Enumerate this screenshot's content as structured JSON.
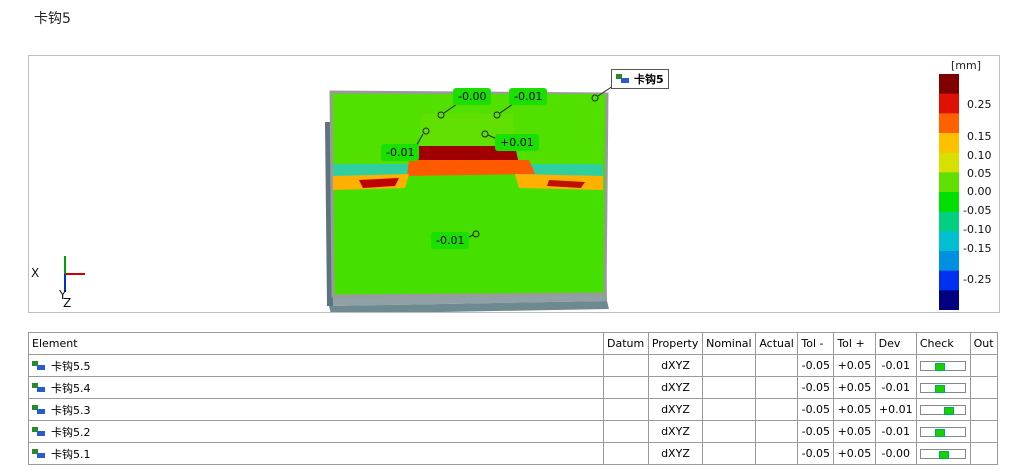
{
  "page": {
    "title": "卡钩5"
  },
  "viewport": {
    "tag_label": "卡钩5",
    "annotations": [
      {
        "id": "a1",
        "value": "-0.00"
      },
      {
        "id": "a2",
        "value": "-0.01"
      },
      {
        "id": "a3",
        "value": "-0.01"
      },
      {
        "id": "a4",
        "value": "+0.01"
      },
      {
        "id": "a5",
        "value": "-0.01"
      }
    ],
    "legend": {
      "unit": "[mm]",
      "ticks": [
        "0.25",
        "0.15",
        "0.10",
        "0.05",
        "0.00",
        "-0.05",
        "-0.10",
        "-0.15",
        "-0.25"
      ],
      "colors": [
        "#800000",
        "#e01000",
        "#ff6000",
        "#ffc000",
        "#d8e000",
        "#60e000",
        "#00e000",
        "#00d080",
        "#00c0d0",
        "#0090e0",
        "#0030f0",
        "#000080"
      ]
    },
    "axes": {
      "x": "X",
      "y": "Y",
      "z": "Z"
    }
  },
  "table": {
    "headers": [
      "Element",
      "Datum",
      "Property",
      "Nominal",
      "Actual",
      "Tol -",
      "Tol +",
      "Dev",
      "Check",
      "Out"
    ],
    "rows": [
      {
        "element": "卡钩5.5",
        "datum": "",
        "property": "dXYZ",
        "nominal": "",
        "actual": "",
        "tol_minus": "-0.05",
        "tol_plus": "+0.05",
        "dev": "-0.01",
        "check_pos": -0.2,
        "out": ""
      },
      {
        "element": "卡钩5.4",
        "datum": "",
        "property": "dXYZ",
        "nominal": "",
        "actual": "",
        "tol_minus": "-0.05",
        "tol_plus": "+0.05",
        "dev": "-0.01",
        "check_pos": -0.2,
        "out": ""
      },
      {
        "element": "卡钩5.3",
        "datum": "",
        "property": "dXYZ",
        "nominal": "",
        "actual": "",
        "tol_minus": "-0.05",
        "tol_plus": "+0.05",
        "dev": "+0.01",
        "check_pos": 0.2,
        "out": ""
      },
      {
        "element": "卡钩5.2",
        "datum": "",
        "property": "dXYZ",
        "nominal": "",
        "actual": "",
        "tol_minus": "-0.05",
        "tol_plus": "+0.05",
        "dev": "-0.01",
        "check_pos": -0.2,
        "out": ""
      },
      {
        "element": "卡钩5.1",
        "datum": "",
        "property": "dXYZ",
        "nominal": "",
        "actual": "",
        "tol_minus": "-0.05",
        "tol_plus": "+0.05",
        "dev": "-0.00",
        "check_pos": 0.0,
        "out": ""
      }
    ]
  }
}
